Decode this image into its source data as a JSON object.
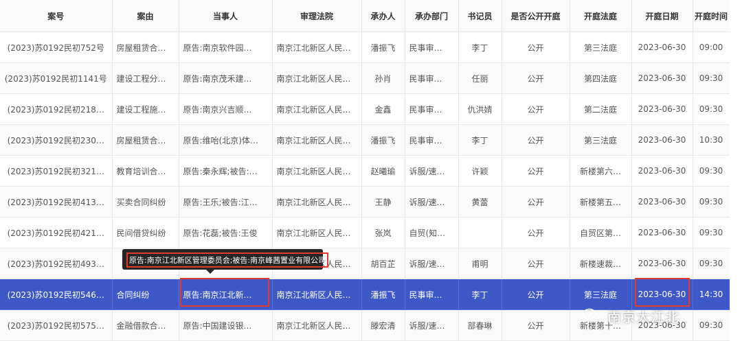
{
  "columns": [
    "案号",
    "案由",
    "当事人",
    "审理法院",
    "承办人",
    "承办部门",
    "书记员",
    "是否公开开庭",
    "开庭法庭",
    "开庭日期",
    "开庭时间"
  ],
  "rows": [
    {
      "case_no": "(2023)苏0192民初752号",
      "cause": "房屋租赁合…",
      "party": "原告:南京软件园…",
      "court": "南京江北新区人民…",
      "judge": "潘振飞",
      "dept": "民事审…",
      "clerk": "李丁",
      "public": "公开",
      "room": "第三法庭",
      "date": "2023-06-30",
      "time": "09:00"
    },
    {
      "case_no": "(2023)苏0192民初1141号",
      "cause": "建设工程分…",
      "party": "原告:南京茂禾建…",
      "court": "南京江北新区人民…",
      "judge": "孙肖",
      "dept": "民事审…",
      "clerk": "任丽",
      "public": "公开",
      "room": "第四法庭",
      "date": "2023-06-30",
      "time": "09:30"
    },
    {
      "case_no": "(2023)苏0192民初218…",
      "cause": "建设工程施…",
      "party": "原告:南京兴吉顺…",
      "court": "南京江北新区人民…",
      "judge": "金鑫",
      "dept": "民事审…",
      "clerk": "仇洪婧",
      "public": "公开",
      "room": "第二法庭",
      "date": "2023-06-30",
      "time": "09:30"
    },
    {
      "case_no": "(2023)苏0192民初230…",
      "cause": "房屋租赁合…",
      "party": "原告:维咍(北京)体…",
      "court": "南京江北新区人民…",
      "judge": "潘振飞",
      "dept": "民事审…",
      "clerk": "李丁",
      "public": "公开",
      "room": "第三法庭",
      "date": "2023-06-30",
      "time": "10:30"
    },
    {
      "case_no": "(2023)苏0192民初321…",
      "cause": "教育培训合…",
      "party": "原告:秦永辉;被告:…",
      "court": "南京江北新区人民…",
      "judge": "赵曦瑜",
      "dept": "诉服/速…",
      "clerk": "许颖",
      "public": "公开",
      "room": "新楼第六…",
      "date": "2023-06-30",
      "time": "09:30"
    },
    {
      "case_no": "(2023)苏0192民初413…",
      "cause": "买卖合同纠纷",
      "party": "原告:王乐;被告:江…",
      "court": "南京江北新区人民…",
      "judge": "王静",
      "dept": "诉服/速…",
      "clerk": "黄蕾",
      "public": "公开",
      "room": "新楼第五…",
      "date": "2023-06-30",
      "time": "09:30"
    },
    {
      "case_no": "(2023)苏0192民初421…",
      "cause": "民间借贷纠纷",
      "party": "原告:花磊;被告:王俊",
      "court": "南京江北新区人民…",
      "judge": "张岚",
      "dept": "自贸(知…",
      "clerk": "",
      "public": "公开",
      "room": "自贸区第…",
      "date": "2023-06-30",
      "time": "09:30"
    },
    {
      "case_no": "(2023)苏0192民初493…",
      "cause": "",
      "party": "",
      "court": "南京江北新区人民…",
      "judge": "胡百芷",
      "dept": "诉服/速…",
      "clerk": "甫明",
      "public": "公开",
      "room": "新楼速裁…",
      "date": "2023-06-30",
      "time": "09:30"
    },
    {
      "case_no": "(2023)苏0192民初546…",
      "cause": "合同纠纷",
      "party": "原告:南京江北新…",
      "court": "南京江北新区人民…",
      "judge": "潘振飞",
      "dept": "民事审…",
      "clerk": "李丁",
      "public": "公开",
      "room": "第三法庭",
      "date": "2023-06-30",
      "time": "14:30"
    },
    {
      "case_no": "(2023)苏0192民初575…",
      "cause": "金融借款合…",
      "party": "原告:中国建设银…",
      "court": "南京江北新区人民…",
      "judge": "滕宏清",
      "dept": "诉服/速…",
      "clerk": "部春琳",
      "public": "公开",
      "room": "新楼第十…",
      "date": "2023-06-30",
      "time": "09:30"
    }
  ],
  "selected_row": 8,
  "tooltip_text": "原告:南京江北新区管理委员会;被告:南京峰茜置业有限公司",
  "watermark": {
    "icon": "wechat-icon",
    "text": "南京大江北"
  },
  "colors": {
    "selected_row": "#3f58c8",
    "highlight": "#e23b2e",
    "tooltip_bg": "#262626"
  }
}
